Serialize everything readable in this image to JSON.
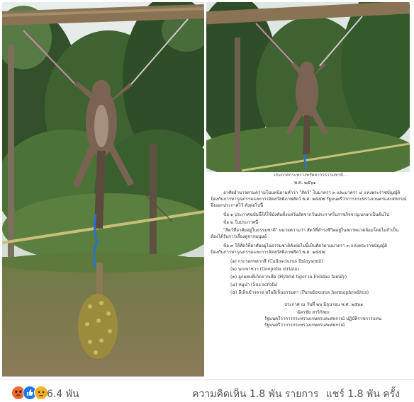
{
  "post": {
    "reactions": {
      "icons": [
        "angry-icon",
        "like-icon",
        "sad-icon"
      ],
      "count": "6.4 พัน"
    },
    "comments": "ความคิดเห็น 1.8 พัน รายการ",
    "shares": "แชร์ 1.8 พัน ครั้ง"
  },
  "document": {
    "header": "ประกาศกระทรวงทรัพยากรธรรมชาติ...",
    "year": "พ.ศ. ๒๕๖๑",
    "lines": [
      "อาศัยอำนาจตามความในบทนิยามคำว่า \"สัตว์\" ในมาตรา ๓ และมาตรา ๔ แห่งพระราชบัญญัติ",
      "ป้องกันการทารุณกรรมและการจัดสวัสดิภาพสัตว์ พ.ศ. ๒๕๕๗ รัฐมนตรีว่าการกระทรวงเกษตรและสหกรณ์",
      "จึงออกประกาศไว้ ดังต่อไปนี้",
      "ข้อ ๑  ประกาศฉบับนี้ให้ใช้บังคับตั้งแต่วันถัดจากวันประกาศในราชกิจจานุเบกษาเป็นต้นไป",
      "ข้อ ๒  ในประกาศนี้",
      "\"สัตว์ที่อาศัยอยู่ในธรรมชาติ\" หมายความว่า สัตว์ที่ดำรงชีวิตอยู่ในสภาพแวดล้อมโดยไม่จำเป็น",
      "ต้องได้รับการเลี้ยงดูจากมนุษย์",
      "ข้อ ๓  ให้สัตว์ที่อาศัยอยู่ในธรรมชาติดังต่อไปนี้เป็นสัตว์ตามมาตรา ๓ แห่งพระราชบัญญัติ",
      "ป้องกันการทารุณกรรมและการจัดสวัสดิภาพสัตว์ พ.ศ. ๒๕๕๗"
    ],
    "species": [
      "(๑) กระรอกหลากสี (Callosciurus finlaysonii)",
      "(๒) นกเขาชวา (Geopelia striata)",
      "(๓) ลูกผสมที่เกิดจากเสือ (Hybrid tiger in Felidae family)",
      "(๔) หมูป่า (Sus scrofa)",
      "(๕) อีเห็นข้างลาย หรืออีเห็นธรรมดา (Paradoxurus hermaphroditus)"
    ],
    "date": "ประกาศ ณ วันที่ ๒๖ มิถุนายน พ.ศ. ๒๕๖๑",
    "signer": "ฉัตรชัย  สาริกัลยะ",
    "position1": "รัฐมนตรีว่าการกระทรวงเกษตรและสหกรณ์  ปฏิบัติราชการแทน",
    "position2": "รัฐมนตรีว่าการกระทรวงเกษตรและสหกรณ์"
  },
  "colors": {
    "angry": "#f0692b",
    "like": "#1877f2",
    "sad": "#f7b125"
  }
}
